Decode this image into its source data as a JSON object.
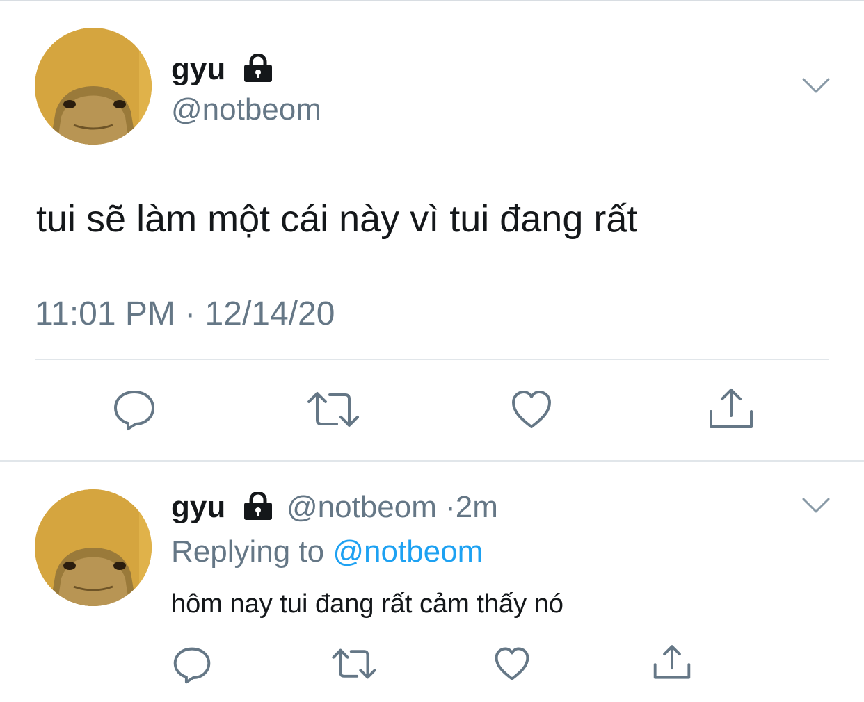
{
  "main_tweet": {
    "user": {
      "name": "gyu",
      "handle": "@notbeom",
      "avatar_icon": "lizard-avatar",
      "protected_icon": "lock-icon"
    },
    "text": "tui sẽ làm một cái này vì tui đang rất",
    "timestamp": "11:01 PM · 12/14/20",
    "actions": [
      "reply-icon",
      "retweet-icon",
      "like-icon",
      "share-icon"
    ]
  },
  "reply_tweet": {
    "user": {
      "name": "gyu",
      "handle": "@notbeom",
      "avatar_icon": "lizard-avatar",
      "protected_icon": "lock-icon"
    },
    "meta_separator": "·",
    "age": "2m",
    "replying_prefix": "Replying to",
    "replying_to": "@notbeom",
    "text": "hôm nay tui đang rất cảm thấy nó",
    "actions": [
      "reply-icon",
      "retweet-icon",
      "like-icon",
      "share-icon"
    ]
  },
  "colors": {
    "text_primary": "#14171a",
    "text_secondary": "#657786",
    "link": "#1da1f2",
    "divider": "#e1e6ea",
    "avatar_background": "#d5a53f"
  }
}
